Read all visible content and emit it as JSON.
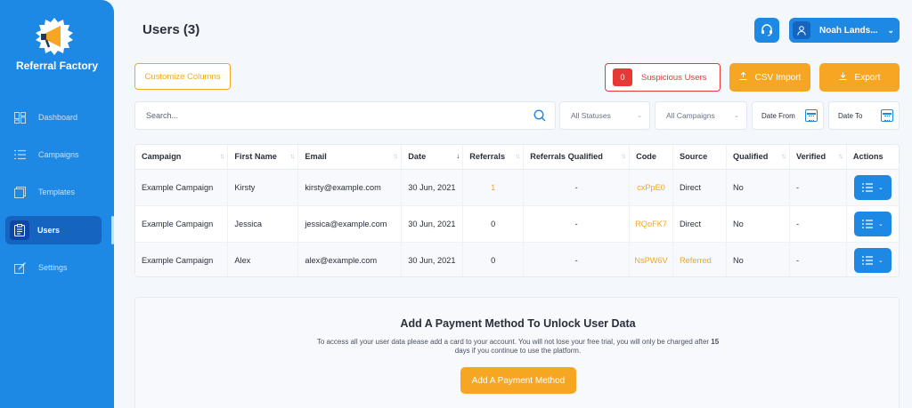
{
  "brand": {
    "name": "Referral Factory"
  },
  "sidebar": {
    "items": [
      {
        "label": "Dashboard",
        "icon": "dashboard-icon"
      },
      {
        "label": "Campaigns",
        "icon": "list-icon"
      },
      {
        "label": "Templates",
        "icon": "template-icon"
      },
      {
        "label": "Users",
        "icon": "clipboard-icon",
        "active": true
      },
      {
        "label": "Settings",
        "icon": "edit-icon"
      }
    ]
  },
  "header": {
    "title": "Users (3)",
    "user_name": "Noah Lands..."
  },
  "toolbar": {
    "customize_label": "Customize Columns",
    "suspicious_count": "0",
    "suspicious_label": "Suspicious Users",
    "csv_import_label": "CSV Import",
    "export_label": "Export"
  },
  "filters": {
    "search_placeholder": "Search...",
    "statuses": "All Statuses",
    "campaigns": "All Campaigns",
    "date_from": "Date From",
    "date_to": "Date To"
  },
  "table": {
    "columns": [
      "Campaign",
      "First Name",
      "Email",
      "Date",
      "Referrals",
      "Referrals Qualified",
      "Code",
      "Source",
      "Qualified",
      "Verified",
      "Actions"
    ],
    "rows": [
      {
        "campaign": "Example Campaign",
        "first_name": "Kirsty",
        "email": "kirsty@example.com",
        "date": "30 Jun, 2021",
        "referrals": "1",
        "referrals_qualified": "-",
        "code": "cxPpE0",
        "source": "Direct",
        "qualified": "No",
        "verified": "-"
      },
      {
        "campaign": "Example Campaign",
        "first_name": "Jessica",
        "email": "jessica@example.com",
        "date": "30 Jun, 2021",
        "referrals": "0",
        "referrals_qualified": "-",
        "code": "RQoFK7",
        "source": "Direct",
        "qualified": "No",
        "verified": "-"
      },
      {
        "campaign": "Example Campaign",
        "first_name": "Alex",
        "email": "alex@example.com",
        "date": "30 Jun, 2021",
        "referrals": "0",
        "referrals_qualified": "-",
        "code": "NsPW6V",
        "source": "Referred",
        "qualified": "No",
        "verified": "-"
      }
    ]
  },
  "payment": {
    "title": "Add A Payment Method To Unlock User Data",
    "text_1": "To access all your user data please add a card to your account. You will not lose your free trial, you will only be charged after ",
    "days": "15",
    "text_2": " days if you continue to use the platform.",
    "button_label": "Add A Payment Method"
  },
  "colors": {
    "primary": "#1e88e5",
    "accent": "#f6a623",
    "danger": "#e53935"
  }
}
